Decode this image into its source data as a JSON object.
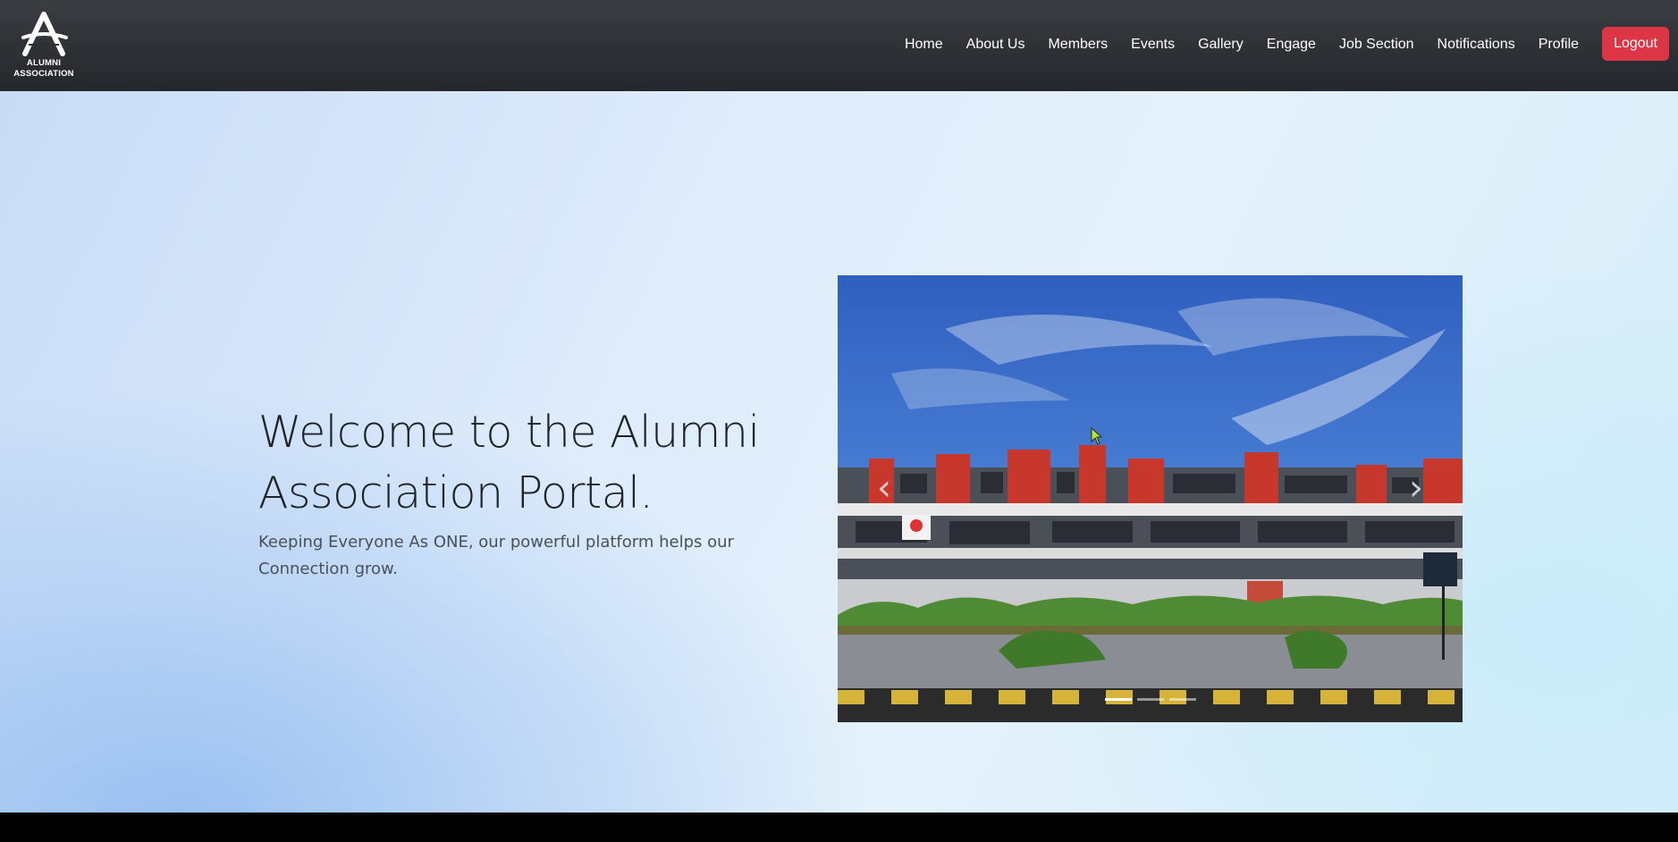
{
  "brand": {
    "logo_icon": "alumni-a-logo",
    "line1": "ALUMNI",
    "line2": "ASSOCIATION"
  },
  "nav": {
    "items": [
      {
        "label": "Home"
      },
      {
        "label": "About Us"
      },
      {
        "label": "Members"
      },
      {
        "label": "Events"
      },
      {
        "label": "Gallery"
      },
      {
        "label": "Engage"
      },
      {
        "label": "Job Section"
      },
      {
        "label": "Notifications"
      },
      {
        "label": "Profile"
      }
    ],
    "logout_label": "Logout",
    "logout_color": "#dc3545"
  },
  "hero": {
    "title": "Welcome to the Alumni Association Portal.",
    "subtitle": "Keeping Everyone As ONE, our powerful platform helps our Connection grow."
  },
  "carousel": {
    "prev_icon": "chevron-left-icon",
    "next_icon": "chevron-right-icon",
    "prev_glyph": "‹",
    "next_glyph": "›",
    "slide_count": 3,
    "active_index": 0
  }
}
